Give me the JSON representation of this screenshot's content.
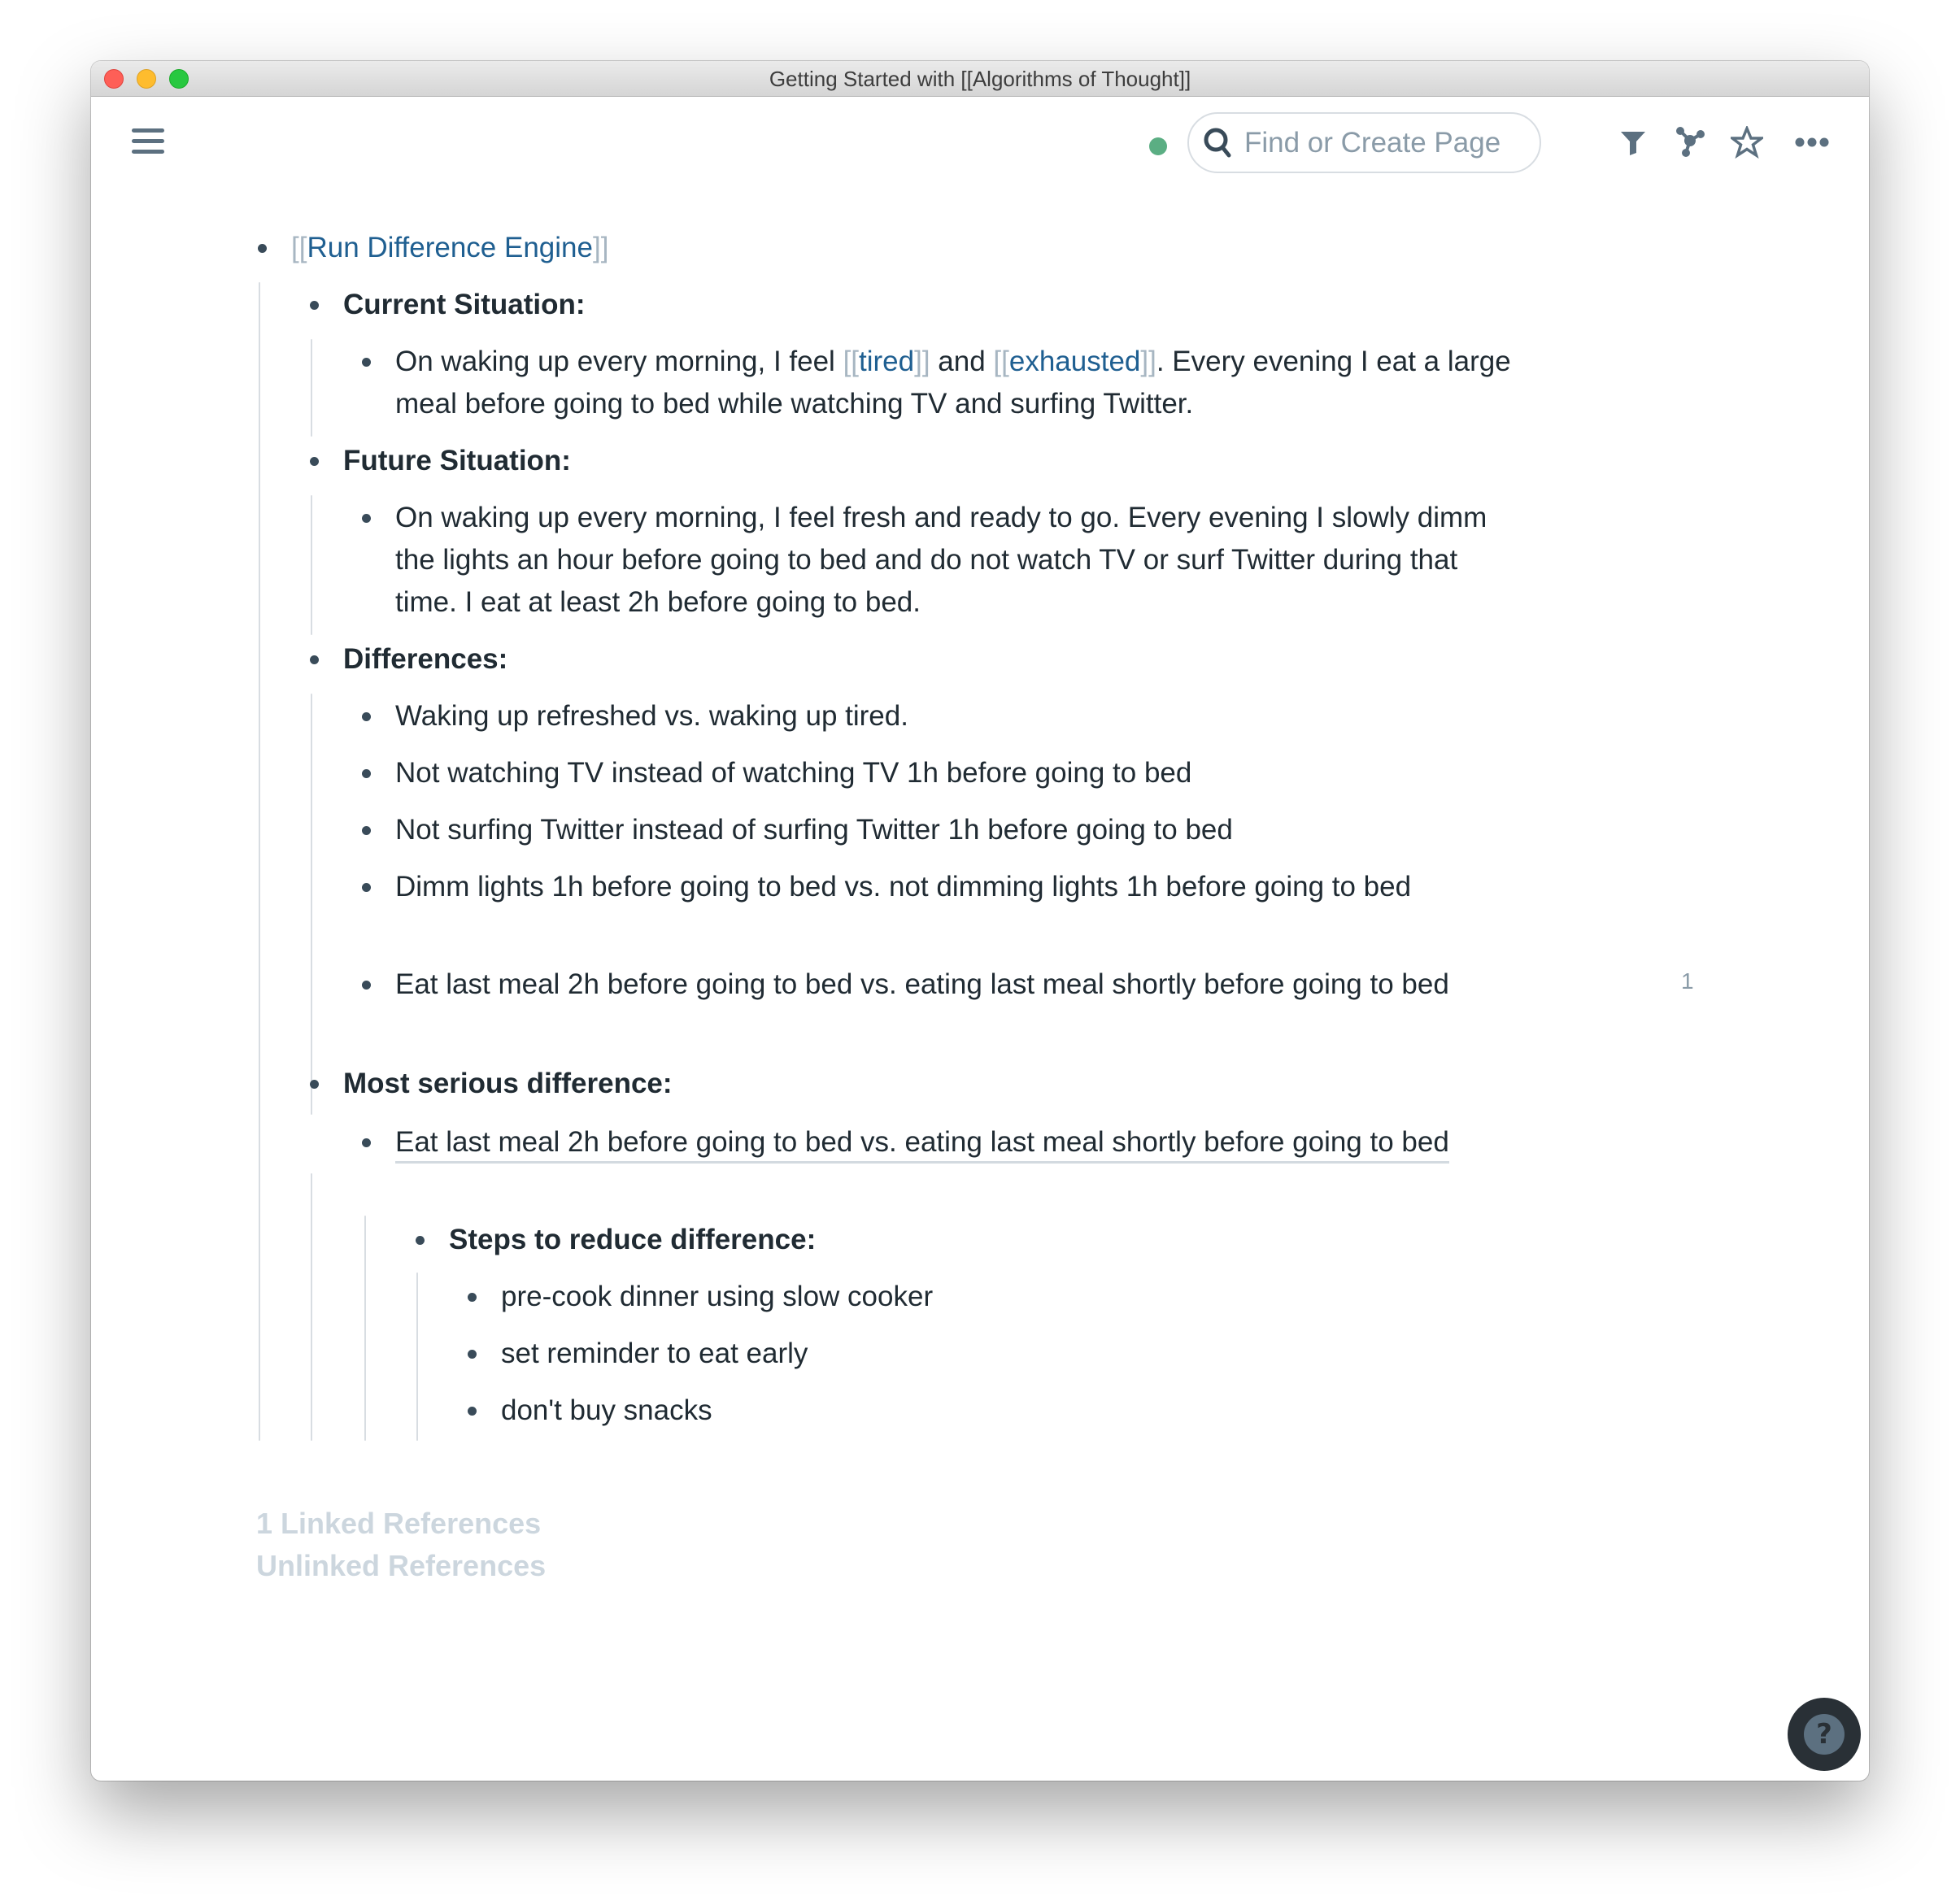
{
  "window": {
    "title": "Getting Started with [[Algorithms of Thought]]"
  },
  "topbar": {
    "menu_icon": "hamburger-menu-icon",
    "sync_status_color": "#5bae83",
    "search": {
      "placeholder": "Find or Create Page",
      "value": "",
      "icon": "search-icon"
    },
    "actions": [
      {
        "name": "filter",
        "icon": "filter-icon"
      },
      {
        "name": "graph",
        "icon": "graph-icon"
      },
      {
        "name": "favorite",
        "icon": "star-icon"
      },
      {
        "name": "more",
        "icon": "more-horizontal-icon"
      }
    ]
  },
  "colors": {
    "text": "#202b33",
    "link": "#1f5f91",
    "link_brackets": "#a7b6c2",
    "muted": "#ccd6de",
    "bullet": "#394b59"
  },
  "outline": {
    "root": {
      "bracket_open": "[[",
      "link": "Run Difference Engine",
      "bracket_close": "]]"
    },
    "current_situation": {
      "heading": "Current Situation:",
      "text_1": "On waking up every morning, I feel ",
      "link_1": "tired",
      "text_2": " and ",
      "link_2": "exhausted",
      "text_3": ". Every evening I eat a large meal before going to bed while watching TV and surfing Twitter."
    },
    "future_situation": {
      "heading": "Future Situation:",
      "text": "On waking up every morning, I feel fresh and ready to go. Every evening I slowly dimm the lights an hour before going to bed and do not watch TV or surf Twitter during that time. I eat at least 2h before going to bed."
    },
    "differences": {
      "heading": "Differences:",
      "items": [
        "Waking up refreshed vs. waking up tired.",
        "Not watching TV instead of watching TV 1h before going to bed",
        "Not surfing Twitter instead of surfing Twitter 1h before going to bed",
        "Dimm lights 1h before going to bed vs. not dimming lights 1h before going to bed",
        "Eat last meal 2h before going to bed vs. eating last meal shortly before going to bed"
      ],
      "block_ref_count": "1"
    },
    "most_serious": {
      "heading": "Most serious difference:",
      "block_ref_text": "Eat last meal 2h before going to bed vs. eating last meal shortly before going to bed",
      "steps_heading": "Steps to reduce difference:",
      "steps": [
        "pre-cook dinner using slow cooker",
        "set reminder to eat early",
        "don't buy snacks"
      ]
    }
  },
  "references": {
    "linked": "1 Linked References",
    "unlinked": "Unlinked References"
  },
  "help": {
    "label": "?"
  }
}
